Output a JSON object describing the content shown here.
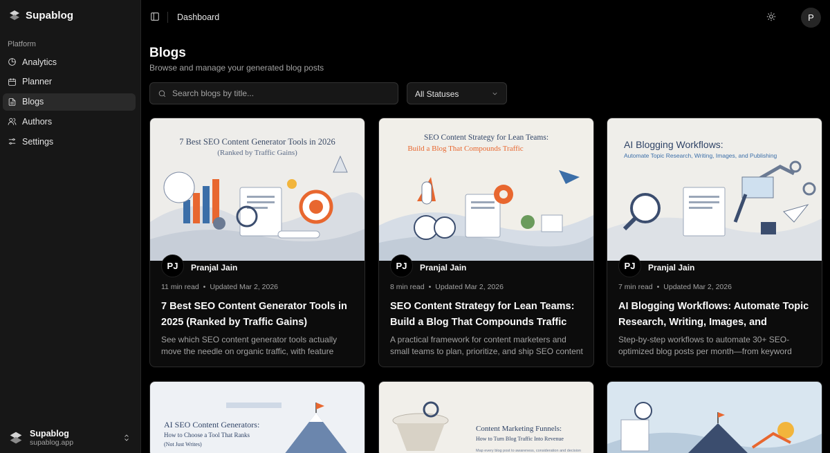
{
  "app": {
    "name": "Supablog",
    "section_label": "Platform",
    "nav": [
      {
        "label": "Analytics",
        "icon": "pie-chart-icon",
        "active": false
      },
      {
        "label": "Planner",
        "icon": "calendar-icon",
        "active": false
      },
      {
        "label": "Blogs",
        "icon": "file-text-icon",
        "active": true
      },
      {
        "label": "Authors",
        "icon": "users-icon",
        "active": false
      },
      {
        "label": "Settings",
        "icon": "sliders-icon",
        "active": false
      }
    ],
    "org": {
      "name": "Supablog",
      "domain": "supablog.app"
    }
  },
  "header": {
    "breadcrumb": "Dashboard",
    "avatar_initial": "P"
  },
  "page": {
    "title": "Blogs",
    "subtitle": "Browse and manage your generated blog posts",
    "search_placeholder": "Search blogs by title...",
    "status_filter": "All Statuses"
  },
  "cards": [
    {
      "image_title": "7 Best SEO Content Generator Tools in 2026",
      "image_subtitle": "(Ranked by Traffic Gains)",
      "image_caption": "See which SEO content generator tools actually move the needle on organic traffic, with feature comparisons, use cases, and pricing breakdowns.",
      "author_initials": "PJ",
      "author_name": "Pranjal Jain",
      "read_time": "11 min read",
      "updated": "Updated Mar 2, 2026",
      "title": "7 Best SEO Content Generator Tools in 2025 (Ranked by Traffic Gains)",
      "excerpt": "See which SEO content generator tools actually move the needle on organic traffic, with feature comparisons, use cases, and pricing breakdowns."
    },
    {
      "image_title": "SEO Content Strategy for Lean Teams:",
      "image_subtitle": "Build a Blog That Compounds Traffic",
      "image_caption": "A practical framework for content marketers and small teams to plan, prioritize, and ship SEO content that compounds instead of burning out your resources.",
      "author_initials": "PJ",
      "author_name": "Pranjal Jain",
      "read_time": "8 min read",
      "updated": "Updated Mar 2, 2026",
      "title": "SEO Content Strategy for Lean Teams: Build a Blog That Compounds Traffic",
      "excerpt": "A practical framework for content marketers and small teams to plan, prioritize, and ship SEO content that compounds instead of burning out your resources."
    },
    {
      "image_title": "AI Blogging Workflows:",
      "image_subtitle": "Automate Topic Research, Writing, Images, and Publishing",
      "image_caption": "Step-by-step workflows to automate 30+ SEO-optimized blog posts per month—from keyword research to AI images and multi-platform publishing.",
      "author_initials": "PJ",
      "author_name": "Pranjal Jain",
      "read_time": "7 min read",
      "updated": "Updated Mar 2, 2026",
      "title": "AI Blogging Workflows: Automate Topic Research, Writing, Images, and Publishing",
      "excerpt": "Step-by-step workflows to automate 30+ SEO-optimized blog posts per month—from keyword research to AI images and multi-platform publishing."
    },
    {
      "image_title": "AI SEO Content Generators:",
      "image_subtitle": "How to Choose a Tool That Ranks",
      "image_caption": "(Not Just Writes)"
    },
    {
      "image_title": "Content Marketing Funnels:",
      "image_subtitle": "How to Turn Blog Traffic Into Revenue",
      "image_caption": "Map every blog post to awareness, consideration and decision"
    },
    {
      "image_title": "",
      "image_subtitle": "",
      "image_caption": ""
    }
  ],
  "colors": {
    "background": "#000000",
    "sidebar": "#171717",
    "accent_orange": "#e8672f",
    "accent_blue": "#3b6ea8"
  }
}
